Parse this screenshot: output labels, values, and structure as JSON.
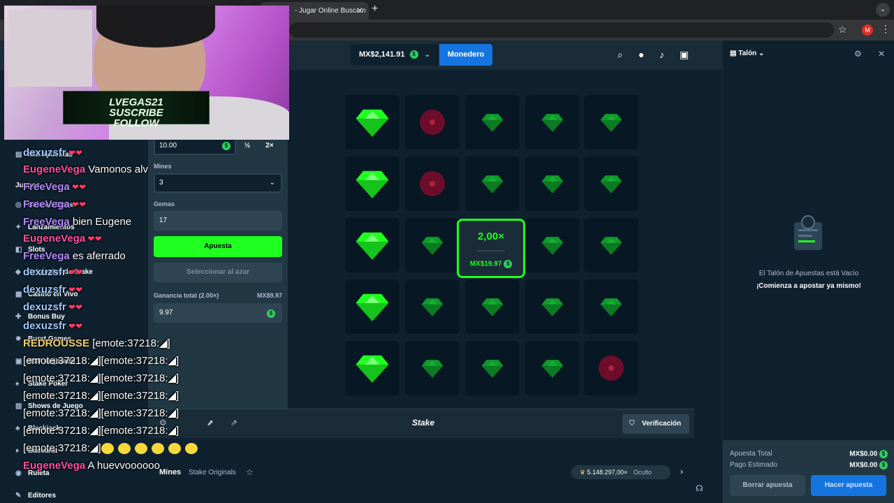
{
  "browser": {
    "tab_title": "- Jugar Online Buscam",
    "new_tab": "+",
    "profile_initial": "M"
  },
  "topbar": {
    "balance": "MX$2,141.91",
    "coin_symbol": "$",
    "wallet_label": "Monedero",
    "icons": [
      "search-icon",
      "user-icon",
      "bell-icon",
      "sidebar-toggle-icon"
    ]
  },
  "sidebar": {
    "items": [
      {
        "label": "Mis Apuestas",
        "icon": "slip-icon"
      },
      {
        "label": "Juegos",
        "icon": ""
      },
      {
        "label": "Solo en Stake",
        "icon": "stake-icon"
      },
      {
        "label": "Lanzamientos",
        "icon": "star-icon"
      },
      {
        "label": "Slots",
        "icon": "slots-icon"
      },
      {
        "label": "Originales de Stake",
        "icon": "originals-icon"
      },
      {
        "label": "Casino en Vivo",
        "icon": "live-icon"
      },
      {
        "label": "Bonus Buy",
        "icon": "bonus-icon"
      },
      {
        "label": "Burst Games",
        "icon": "burst-icon"
      },
      {
        "label": "RTP mejorado",
        "icon": "rtp-icon"
      },
      {
        "label": "Stake Poker",
        "icon": "poker-icon"
      },
      {
        "label": "Shows de Juego",
        "icon": "show-icon"
      },
      {
        "label": "Blackjack",
        "icon": "cards-icon"
      },
      {
        "label": "Baccarat",
        "icon": "cards-icon"
      },
      {
        "label": "Ruleta",
        "icon": "roulette-icon"
      },
      {
        "label": "Editores",
        "icon": "editor-icon"
      }
    ]
  },
  "controls": {
    "bet_amount": "10.00",
    "half_label": "½",
    "double_label": "2×",
    "mines_label": "Mines",
    "mines_value": "3",
    "gems_label": "Gemas",
    "gems_value": "17",
    "bet_button": "Apuesta",
    "random_button": "Seleccionar al azar",
    "profit_label": "Ganancia total (2.00×)",
    "profit_amount": "MX$9.97",
    "profit_value": "9.97"
  },
  "board": {
    "rows": 5,
    "cols": 5,
    "tiles": [
      [
        "gem-revealed",
        "mine",
        "gem",
        "gem",
        "gem"
      ],
      [
        "gem-revealed",
        "mine",
        "gem",
        "gem",
        "gem"
      ],
      [
        "gem-revealed",
        "gem",
        "cashout",
        "gem",
        "gem"
      ],
      [
        "gem-revealed",
        "gem",
        "gem",
        "gem",
        "gem"
      ],
      [
        "gem-revealed",
        "gem",
        "gem",
        "gem",
        "mine"
      ]
    ],
    "cashout_multiplier": "2,00×",
    "cashout_amount": "MX$19.97",
    "colors": {
      "gem_bright": "#1fff20",
      "gem_dim": "#0f9a2a",
      "mine": "#6d0d2a",
      "tile": "#071824"
    }
  },
  "footer": {
    "logo": "Stake",
    "verification": "Verificación",
    "game_title": "Mines",
    "game_sub": "Stake Originals",
    "record": "5.148.297,00×",
    "record_hidden": "Oculto"
  },
  "betslip": {
    "title": "Talón",
    "empty_title": "El Talón de Apuestas está Vacío",
    "empty_cta": "¡Comienza a apostar ya mismo!",
    "total_bet_label": "Apuesta Total",
    "total_bet_value": "MX$0.00",
    "est_payout_label": "Pago Estimado",
    "est_payout_value": "MX$0.00",
    "clear_button": "Borrar apuesta",
    "place_button": "Hacer apuesta"
  },
  "stream": {
    "banner_line1": "LVEGAS21",
    "banner_line2": "SUSCRIBE",
    "banner_line3": "FOLLOW",
    "chat": [
      {
        "user": "dexuzsfr",
        "text": "",
        "color": "blue"
      },
      {
        "user": "EugeneVega",
        "text": "Vamonos alv",
        "color": "pink"
      },
      {
        "user": "FreeVega",
        "text": "",
        "color": "purple"
      },
      {
        "user": "FreeVega",
        "text": "",
        "color": "purple"
      },
      {
        "user": "FreeVega",
        "text": "bien Eugene",
        "color": "purple"
      },
      {
        "user": "EugeneVega",
        "text": "",
        "color": "pink"
      },
      {
        "user": "FreeVega",
        "text": "es aferrado",
        "color": "purple"
      },
      {
        "user": "dexuzsfr",
        "text": "",
        "color": "blue"
      },
      {
        "user": "dexuzsfr",
        "text": "",
        "color": "blue"
      },
      {
        "user": "dexuzsfr",
        "text": "",
        "color": "blue"
      },
      {
        "user": "dexuzsfr",
        "text": "",
        "color": "blue"
      },
      {
        "user": "REDROUSSE",
        "text": "[emote:37218:",
        "color": "gold"
      },
      {
        "user": "",
        "text": "[emote:37218:",
        "color": "white"
      },
      {
        "user": "",
        "text": "[emote:37218:",
        "color": "white"
      },
      {
        "user": "",
        "text": "[emote:37218:",
        "color": "white"
      },
      {
        "user": "",
        "text": "[emote:37218:",
        "color": "white"
      },
      {
        "user": "",
        "text": "[emote:37218:",
        "color": "white"
      },
      {
        "user": "",
        "text": "[emote:37218:",
        "color": "white"
      },
      {
        "user": "EugeneVega",
        "text": "A huevvoooooo",
        "color": "pink"
      }
    ],
    "emote_suffix": "]",
    "double_emote": "][emote:37218:"
  }
}
